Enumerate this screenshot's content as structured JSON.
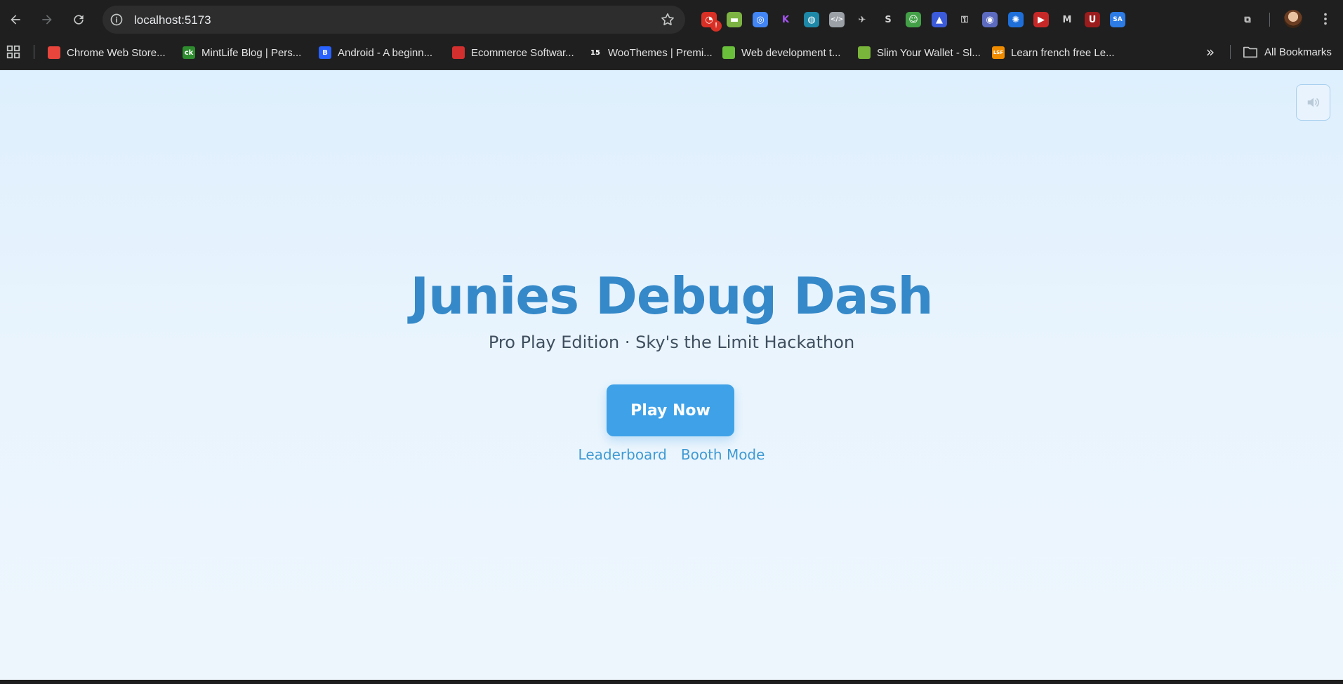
{
  "browser": {
    "url": "localhost:5173",
    "extension_badge": "!",
    "extensions": [
      {
        "icon": "chart-extension-icon",
        "color": "#d93025",
        "glyph": "◔"
      },
      {
        "icon": "glasses-extension-icon",
        "color": "#7cb342",
        "glyph": "▬"
      },
      {
        "icon": "color-wheel-extension-icon",
        "color": "#4285f4",
        "glyph": "◎"
      },
      {
        "icon": "k-extension-icon",
        "color": "#1f1f1f",
        "glyph": "K"
      },
      {
        "icon": "globe-extension-icon",
        "color": "#1e88a8",
        "glyph": "◍"
      },
      {
        "icon": "code-extension-icon",
        "color": "#9aa0a6",
        "glyph": "</>"
      },
      {
        "icon": "bird-extension-icon",
        "color": "#1f1f1f",
        "glyph": "✈"
      },
      {
        "icon": "shopify-extension-icon",
        "color": "#1f1f1f",
        "glyph": "S"
      },
      {
        "icon": "robot-extension-icon",
        "color": "#43a047",
        "glyph": "☺"
      },
      {
        "icon": "mountain-extension-icon",
        "color": "#3b5bdb",
        "glyph": "▲"
      },
      {
        "icon": "lock-extension-icon",
        "color": "#000000",
        "glyph": "⚿"
      },
      {
        "icon": "target-extension-icon",
        "color": "#5c6bc0",
        "glyph": "◉"
      },
      {
        "icon": "gear-extension-icon",
        "color": "#1e6fd9",
        "glyph": "✺"
      },
      {
        "icon": "forward-extension-icon",
        "color": "#c62828",
        "glyph": "▶"
      },
      {
        "icon": "malwarebytes-extension-icon",
        "color": "#1f1f1f",
        "glyph": "M"
      },
      {
        "icon": "ublock-extension-icon",
        "color": "#9b1c1c",
        "glyph": "U"
      },
      {
        "icon": "sa-extension-icon",
        "color": "#2d7be5",
        "glyph": "SA"
      },
      {
        "icon": "puzzle-extensions-icon",
        "color": "#1f1f1f",
        "glyph": "⧉"
      }
    ]
  },
  "bookmarks": {
    "items": [
      {
        "label": "Chrome Web Store...",
        "fav": "",
        "color": "#e8453c"
      },
      {
        "label": "MintLife Blog | Pers...",
        "fav": "ck",
        "color": "#2e8b2e"
      },
      {
        "label": "Android - A beginn...",
        "fav": "B",
        "color": "#2962ff"
      },
      {
        "label": "Ecommerce Softwar...",
        "fav": "",
        "color": "#d32f2f"
      },
      {
        "label": "WooThemes | Premi...",
        "fav": "15",
        "color": "#1f1f1f"
      },
      {
        "label": "Web development t...",
        "fav": "",
        "color": "#6abf3b"
      },
      {
        "label": "Slim Your Wallet - Sl...",
        "fav": "",
        "color": "#79b53a"
      },
      {
        "label": "Learn french free Le...",
        "fav": "LSF",
        "color": "#f08c00"
      }
    ],
    "all_bookmarks": "All Bookmarks"
  },
  "page": {
    "title": "Junies Debug Dash",
    "subtitle": "Pro Play Edition · Sky's the Limit Hackathon",
    "play_button": "Play Now",
    "links": {
      "leaderboard": "Leaderboard",
      "booth_mode": "Booth Mode"
    },
    "sound_icon": "speaker-icon"
  }
}
